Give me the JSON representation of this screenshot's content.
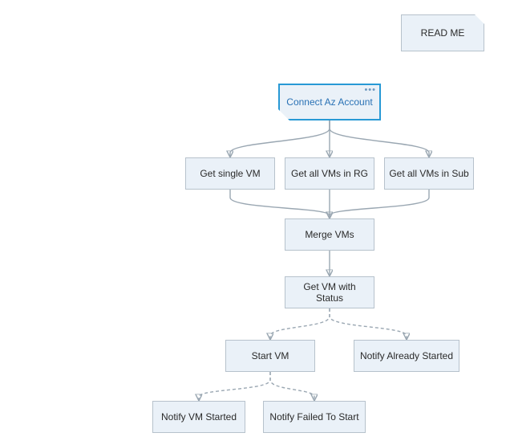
{
  "nodes": {
    "readme": "READ ME",
    "connect": "Connect Az Account",
    "get_single": "Get single VM",
    "get_rg": "Get all VMs in RG",
    "get_sub": "Get all VMs in Sub",
    "merge": "Merge VMs",
    "get_status": "Get VM with Status",
    "start_vm": "Start VM",
    "notify_already": "Notify Already Started",
    "notify_started": "Notify VM Started",
    "notify_failed": "Notify Failed To Start"
  },
  "chart_data": {
    "type": "flowchart",
    "direction": "TB",
    "nodes": [
      {
        "id": "readme",
        "label": "READ ME",
        "shape": "note",
        "detached": true
      },
      {
        "id": "connect",
        "label": "Connect Az Account",
        "shape": "start",
        "selected": true
      },
      {
        "id": "get_single",
        "label": "Get single VM",
        "shape": "process"
      },
      {
        "id": "get_rg",
        "label": "Get all VMs in RG",
        "shape": "process"
      },
      {
        "id": "get_sub",
        "label": "Get all VMs in Sub",
        "shape": "process"
      },
      {
        "id": "merge",
        "label": "Merge VMs",
        "shape": "process"
      },
      {
        "id": "get_status",
        "label": "Get VM with Status",
        "shape": "process"
      },
      {
        "id": "start_vm",
        "label": "Start VM",
        "shape": "process"
      },
      {
        "id": "notify_already",
        "label": "Notify Already Started",
        "shape": "process"
      },
      {
        "id": "notify_started",
        "label": "Notify VM Started",
        "shape": "process"
      },
      {
        "id": "notify_failed",
        "label": "Notify Failed To Start",
        "shape": "process"
      }
    ],
    "edges": [
      {
        "from": "connect",
        "to": "get_single",
        "style": "solid"
      },
      {
        "from": "connect",
        "to": "get_rg",
        "style": "solid"
      },
      {
        "from": "connect",
        "to": "get_sub",
        "style": "solid"
      },
      {
        "from": "get_single",
        "to": "merge",
        "style": "solid"
      },
      {
        "from": "get_rg",
        "to": "merge",
        "style": "solid"
      },
      {
        "from": "get_sub",
        "to": "merge",
        "style": "solid"
      },
      {
        "from": "merge",
        "to": "get_status",
        "style": "solid"
      },
      {
        "from": "get_status",
        "to": "start_vm",
        "style": "dashed"
      },
      {
        "from": "get_status",
        "to": "notify_already",
        "style": "dashed"
      },
      {
        "from": "start_vm",
        "to": "notify_started",
        "style": "dashed"
      },
      {
        "from": "start_vm",
        "to": "notify_failed",
        "style": "dashed"
      }
    ]
  }
}
